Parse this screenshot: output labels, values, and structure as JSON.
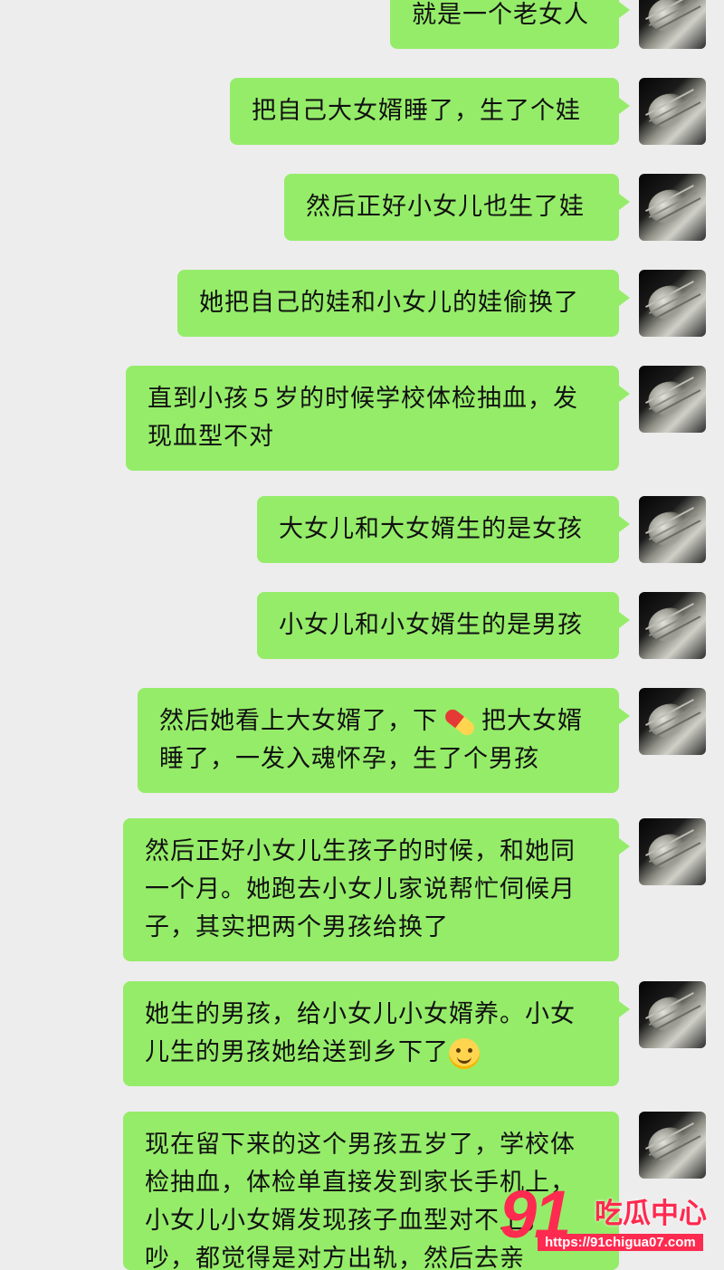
{
  "messages": [
    {
      "text": "就是一个老女人"
    },
    {
      "text": "把自己大女婿睡了，生了个娃"
    },
    {
      "text": "然后正好小女儿也生了娃"
    },
    {
      "text": "她把自己的娃和小女儿的娃偷换了"
    },
    {
      "line1": "直到小孩５岁的时候学校体检抽血，发",
      "line2": "现血型不对"
    },
    {
      "text": "大女儿和大女婿生的是女孩"
    },
    {
      "text": "小女儿和小女婿生的是男孩"
    },
    {
      "line1a": "然后她看上大女婿了，下",
      "line1b": "把大女婿",
      "line2": "睡了，一发入魂怀孕，生了个男孩"
    },
    {
      "line1": "然后正好小女儿生孩子的时候，和她同",
      "line2": "一个月。她跑去小女儿家说帮忙伺候月",
      "line3": "子，其实把两个男孩给换了"
    },
    {
      "line1": "她生的男孩，给小女儿小女婿养。小女",
      "line2": "儿生的男孩她给送到乡下了"
    },
    {
      "line1": "现在留下来的这个男孩五岁了，学校体",
      "line2": "检抽血，体检单直接发到家长手机上，",
      "line3": "小女儿小女婿发现孩子血型对不上，",
      "line4": "吵，都觉得是对方出轨，然后去亲"
    }
  ],
  "icons": {
    "pill": "pill-emoji",
    "smile": "smile-emoji",
    "avatar": "user-avatar"
  },
  "watermark": {
    "number": "91",
    "name": "吃瓜中心",
    "url": "https://91chigua07.com"
  },
  "colors": {
    "background": "#ededed",
    "bubble": "#95ec69",
    "watermark": "#ff2a4f"
  }
}
